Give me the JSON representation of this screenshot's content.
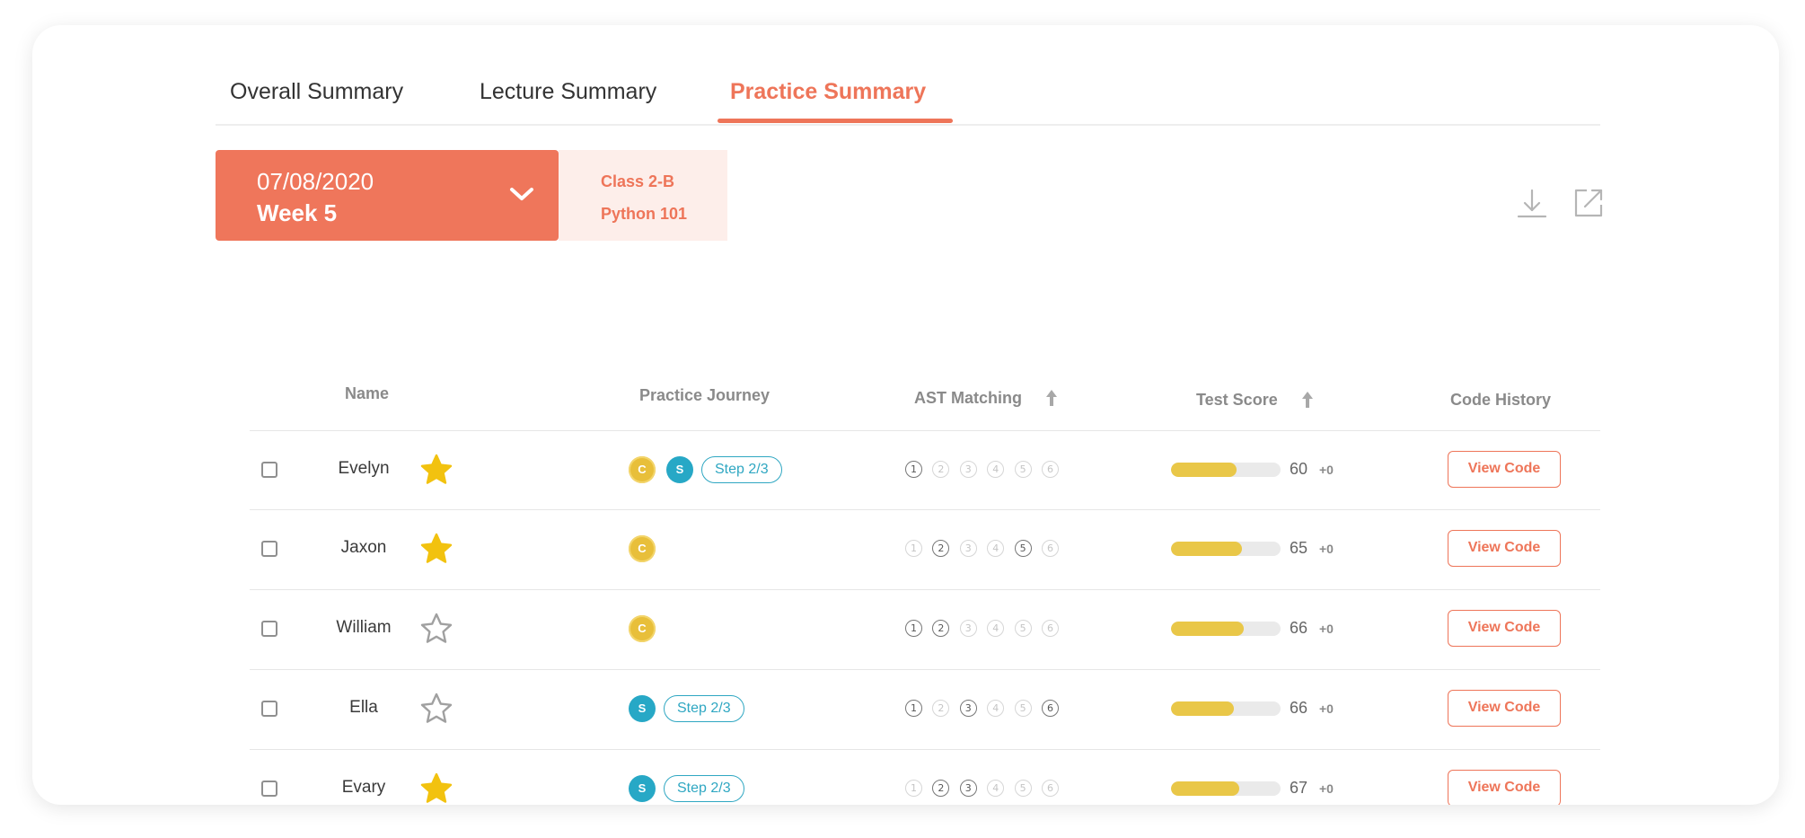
{
  "tabs": [
    {
      "label": "Overall Summary",
      "active": false
    },
    {
      "label": "Lecture Summary",
      "active": false
    },
    {
      "label": "Practice Summary",
      "active": true
    }
  ],
  "week_selector": {
    "date": "07/08/2020",
    "week": "Week 5"
  },
  "class_info": {
    "class": "Class 2-B",
    "course": "Python 101"
  },
  "toolbar": {
    "download_icon": "download-icon",
    "open_icon": "external-link-icon"
  },
  "colors": {
    "accent": "#ee7559",
    "accent_light": "#fdeeea",
    "coin_c": "#e8bf3a",
    "coin_s": "#27a8c6",
    "score_bar": "#e9c748",
    "star_filled": "#f2c20f",
    "star_empty": "#a0a0a0"
  },
  "table": {
    "headers": {
      "name": "Name",
      "journey": "Practice Journey",
      "ast": "AST Matching",
      "test": "Test Score",
      "code": "Code History"
    },
    "rows": [
      {
        "name": "Evelyn",
        "starred": true,
        "coin_c": "C",
        "coin_s": "S",
        "step": "Step  2/3",
        "ast_active": [
          1
        ],
        "score_fraction": 0.6,
        "score": "60",
        "delta": "+0",
        "button": "View Code"
      },
      {
        "name": "Jaxon",
        "starred": true,
        "coin_c": "C",
        "ast_active": [
          2,
          5
        ],
        "score_fraction": 0.65,
        "score": "65",
        "delta": "+0",
        "button": "View Code"
      },
      {
        "name": "William",
        "starred": false,
        "coin_c": "C",
        "ast_active": [
          1,
          2
        ],
        "score_fraction": 0.66,
        "score": "66",
        "delta": "+0",
        "button": "View Code"
      },
      {
        "name": "Ella",
        "starred": false,
        "coin_s": "S",
        "step": "Step  2/3",
        "ast_active": [
          1,
          3,
          6
        ],
        "score_fraction": 0.57,
        "score": "66",
        "delta": "+0",
        "button": "View Code"
      },
      {
        "name": "Evary",
        "starred": true,
        "coin_s": "S",
        "step": "Step  2/3",
        "ast_active": [
          2,
          3
        ],
        "score_fraction": 0.62,
        "score": "67",
        "delta": "+0",
        "button": "View Code"
      }
    ]
  }
}
